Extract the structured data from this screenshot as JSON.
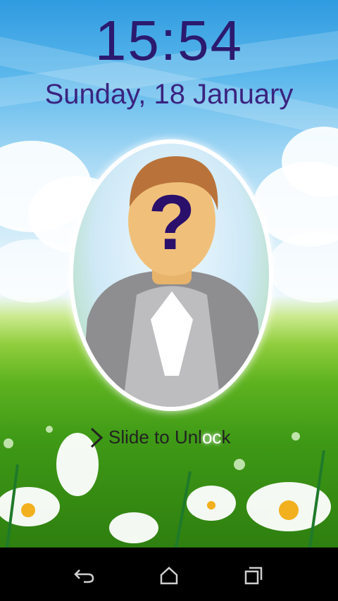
{
  "lockscreen": {
    "time": "15:54",
    "date": "Sunday, 18 January",
    "slide_prefix": "Slide to Unl",
    "slide_highlight": "oc",
    "slide_suffix": "k"
  },
  "avatar": {
    "icon": "unknown-person-icon",
    "glyph": "?"
  },
  "navbar": {
    "back_icon": "back-icon",
    "home_icon": "home-icon",
    "recents_icon": "recents-icon"
  },
  "colors": {
    "clock_text": "#2b1a6f",
    "navbar_bg": "#000000",
    "question_mark": "#2a0f6b"
  }
}
